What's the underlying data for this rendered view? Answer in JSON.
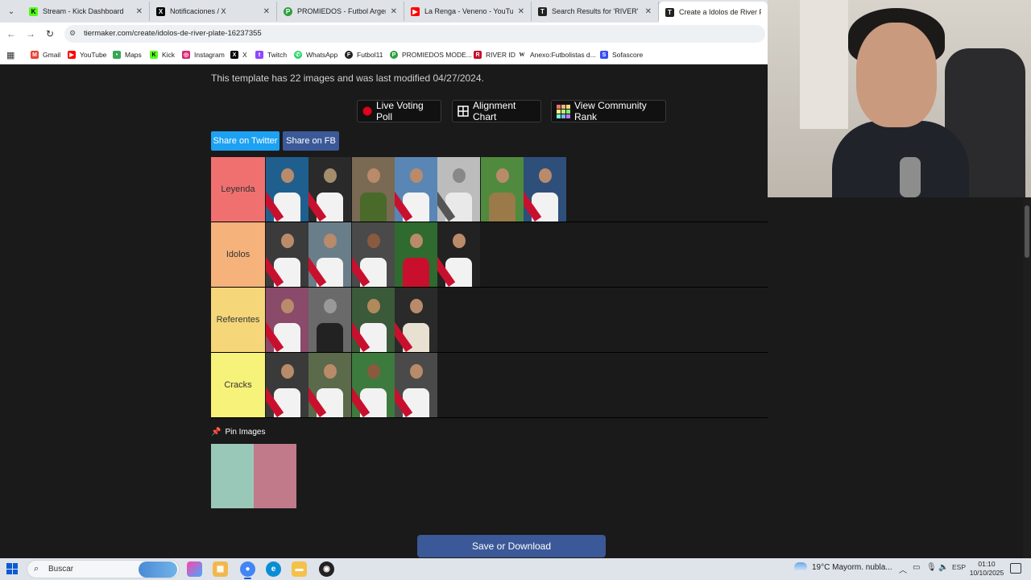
{
  "tabs": [
    {
      "title": "Stream - Kick Dashboard",
      "icon": "kick-icon",
      "color": "#53fc18",
      "active": false
    },
    {
      "title": "Notificaciones / X",
      "icon": "x-icon",
      "color": "#000000",
      "active": false
    },
    {
      "title": "PROMIEDOS - Futbol Argentina",
      "icon": "promiedos-icon",
      "color": "#2e9e3e",
      "active": false
    },
    {
      "title": "La Renga - Veneno - YouTube",
      "icon": "youtube-icon",
      "color": "#ff0000",
      "active": false
    },
    {
      "title": "Search Results for 'RIVER' - Tier",
      "icon": "tiermaker-icon",
      "color": "#222222",
      "active": false
    },
    {
      "title": "Create a Idolos de River Plate T",
      "icon": "tiermaker-icon",
      "color": "#222222",
      "active": true
    }
  ],
  "address": {
    "url": "tiermaker.com/create/idolos-de-river-plate-16237355"
  },
  "bookmarks": [
    {
      "label": "Gmail",
      "icon": "gmail-icon",
      "color": "#ea4335"
    },
    {
      "label": "YouTube",
      "icon": "youtube-icon",
      "color": "#ff0000"
    },
    {
      "label": "Maps",
      "icon": "maps-icon",
      "color": "#34a853"
    },
    {
      "label": "Kick",
      "icon": "kick-icon",
      "color": "#53fc18"
    },
    {
      "label": "Instagram",
      "icon": "instagram-icon",
      "color": "#d62976"
    },
    {
      "label": "X",
      "icon": "x-icon",
      "color": "#000000"
    },
    {
      "label": "Twitch",
      "icon": "twitch-icon",
      "color": "#9146ff"
    },
    {
      "label": "WhatsApp",
      "icon": "whatsapp-icon",
      "color": "#25d366"
    },
    {
      "label": "Futbol11",
      "icon": "futbol11-icon",
      "color": "#222222"
    },
    {
      "label": "PROMIEDOS MODE...",
      "icon": "promiedos-icon",
      "color": "#2e9e3e"
    },
    {
      "label": "RIVER ID",
      "icon": "river-icon",
      "color": "#c8102e"
    },
    {
      "label": "Anexo:Futbolistas d...",
      "icon": "wikipedia-icon",
      "color": "#555555"
    },
    {
      "label": "Sofascore",
      "icon": "sofascore-icon",
      "color": "#374df5"
    }
  ],
  "page": {
    "template_info": "This template has 22 images and was last modified 04/27/2024.",
    "buttons": {
      "live_voting": "Live Voting Poll",
      "alignment": "Alignment Chart",
      "community": "View Community Rank"
    },
    "share": {
      "twitter": "Share on Twitter",
      "fb": "Share on FB"
    },
    "tiers": [
      {
        "label": "Leyenda",
        "color": "#f07070",
        "items": 7
      },
      {
        "label": "Idolos",
        "color": "#f5b27a",
        "items": 5
      },
      {
        "label": "Referentes",
        "color": "#f5d77a",
        "items": 4
      },
      {
        "label": "Cracks",
        "color": "#f7f27a",
        "items": 4
      }
    ],
    "pin_title": "Pin Images",
    "pin_items": 2,
    "save": "Save or Download"
  },
  "taskbar": {
    "search_placeholder": "Buscar",
    "weather": "19°C  Mayorm. nubla...",
    "lang": "ESP",
    "time": "01:10",
    "date": "10/10/2025"
  }
}
